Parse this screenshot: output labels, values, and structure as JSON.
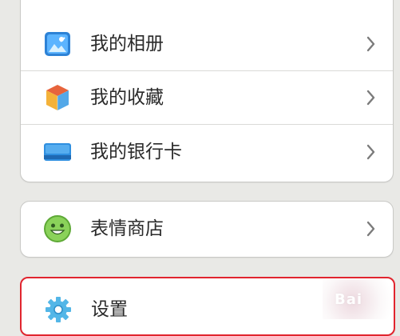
{
  "menu": {
    "group1": [
      {
        "label": "我的相册",
        "icon": "photo-album-icon"
      },
      {
        "label": "我的收藏",
        "icon": "favorites-box-icon"
      },
      {
        "label": "我的银行卡",
        "icon": "bank-card-icon"
      }
    ],
    "group2": [
      {
        "label": "表情商店",
        "icon": "smiley-face-icon"
      }
    ],
    "group3": [
      {
        "label": "设置",
        "icon": "settings-gear-icon"
      }
    ]
  },
  "overlay": {
    "watermark_text": "Bai"
  },
  "colors": {
    "background": "#e9e9e6",
    "card": "#ffffff",
    "highlight_border": "#e1252f",
    "text": "#2a2a2a"
  }
}
